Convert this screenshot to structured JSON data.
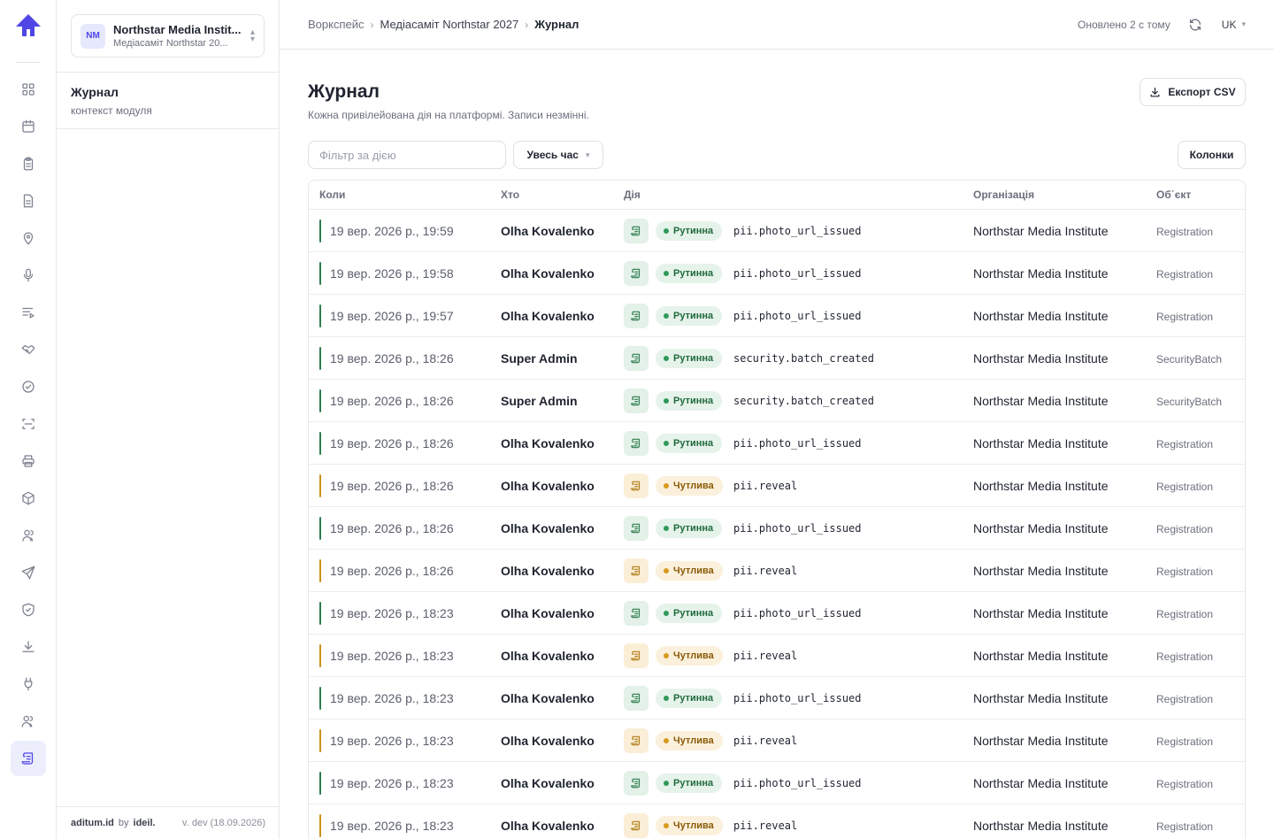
{
  "app": {
    "accent": "#4f46e5"
  },
  "rail": {
    "items": [
      {
        "icon": "dashboard-icon"
      },
      {
        "icon": "calendar-icon"
      },
      {
        "icon": "clipboard-icon"
      },
      {
        "icon": "document-icon"
      },
      {
        "icon": "location-pin-icon"
      },
      {
        "icon": "microphone-icon"
      },
      {
        "icon": "playlist-icon"
      },
      {
        "icon": "handshake-icon"
      },
      {
        "icon": "check-circle-icon"
      },
      {
        "icon": "scan-icon"
      },
      {
        "icon": "printer-icon"
      },
      {
        "icon": "package-icon"
      },
      {
        "icon": "users-icon"
      },
      {
        "icon": "send-icon"
      },
      {
        "icon": "shield-check-icon"
      },
      {
        "icon": "download-icon"
      },
      {
        "icon": "plug-icon"
      },
      {
        "icon": "team-icon"
      },
      {
        "icon": "scroll-icon",
        "active": true
      }
    ]
  },
  "org_switcher": {
    "initials": "NM",
    "name": "Northstar Media Instit...",
    "subtitle": "Медіасаміт Northstar 20..."
  },
  "context": {
    "title": "Журнал",
    "subtitle": "контекст модуля"
  },
  "footer": {
    "brand": "aditum.id",
    "by": "by",
    "vendor": "ideil.",
    "version": "v. dev (18.09.2026)"
  },
  "topbar": {
    "breadcrumb": [
      "Воркспейс",
      "Медіасаміт Northstar 2027",
      "Журнал"
    ],
    "separator": "›",
    "updated": "Оновлено 2 с тому",
    "language": "UK"
  },
  "page": {
    "title": "Журнал",
    "subtitle": "Кожна привілейована дія на платформі. Записи незмінні.",
    "export_label": "Експорт CSV",
    "filter_placeholder": "Фільтр за дією",
    "period_label": "Увесь час",
    "columns_label": "Колонки"
  },
  "table": {
    "headers": {
      "when": "Коли",
      "who": "Хто",
      "action": "Дія",
      "org": "Організація",
      "object": "Об΄єкт"
    },
    "severity_colors": {
      "routine": "#2f7d4f",
      "sensitive": "#c9921e"
    },
    "rows": [
      {
        "when": "19 вер. 2026 р., 19:59",
        "who": "Olha Kovalenko",
        "severity": "routine",
        "badge": "Рутинна",
        "action": "pii.photo_url_issued",
        "org": "Northstar Media Institute",
        "object": "Registration"
      },
      {
        "when": "19 вер. 2026 р., 19:58",
        "who": "Olha Kovalenko",
        "severity": "routine",
        "badge": "Рутинна",
        "action": "pii.photo_url_issued",
        "org": "Northstar Media Institute",
        "object": "Registration"
      },
      {
        "when": "19 вер. 2026 р., 19:57",
        "who": "Olha Kovalenko",
        "severity": "routine",
        "badge": "Рутинна",
        "action": "pii.photo_url_issued",
        "org": "Northstar Media Institute",
        "object": "Registration"
      },
      {
        "when": "19 вер. 2026 р., 18:26",
        "who": "Super Admin",
        "severity": "routine",
        "badge": "Рутинна",
        "action": "security.batch_created",
        "org": "Northstar Media Institute",
        "object": "SecurityBatch"
      },
      {
        "when": "19 вер. 2026 р., 18:26",
        "who": "Super Admin",
        "severity": "routine",
        "badge": "Рутинна",
        "action": "security.batch_created",
        "org": "Northstar Media Institute",
        "object": "SecurityBatch"
      },
      {
        "when": "19 вер. 2026 р., 18:26",
        "who": "Olha Kovalenko",
        "severity": "routine",
        "badge": "Рутинна",
        "action": "pii.photo_url_issued",
        "org": "Northstar Media Institute",
        "object": "Registration"
      },
      {
        "when": "19 вер. 2026 р., 18:26",
        "who": "Olha Kovalenko",
        "severity": "sensitive",
        "badge": "Чутлива",
        "action": "pii.reveal",
        "org": "Northstar Media Institute",
        "object": "Registration"
      },
      {
        "when": "19 вер. 2026 р., 18:26",
        "who": "Olha Kovalenko",
        "severity": "routine",
        "badge": "Рутинна",
        "action": "pii.photo_url_issued",
        "org": "Northstar Media Institute",
        "object": "Registration"
      },
      {
        "when": "19 вер. 2026 р., 18:26",
        "who": "Olha Kovalenko",
        "severity": "sensitive",
        "badge": "Чутлива",
        "action": "pii.reveal",
        "org": "Northstar Media Institute",
        "object": "Registration"
      },
      {
        "when": "19 вер. 2026 р., 18:23",
        "who": "Olha Kovalenko",
        "severity": "routine",
        "badge": "Рутинна",
        "action": "pii.photo_url_issued",
        "org": "Northstar Media Institute",
        "object": "Registration"
      },
      {
        "when": "19 вер. 2026 р., 18:23",
        "who": "Olha Kovalenko",
        "severity": "sensitive",
        "badge": "Чутлива",
        "action": "pii.reveal",
        "org": "Northstar Media Institute",
        "object": "Registration"
      },
      {
        "when": "19 вер. 2026 р., 18:23",
        "who": "Olha Kovalenko",
        "severity": "routine",
        "badge": "Рутинна",
        "action": "pii.photo_url_issued",
        "org": "Northstar Media Institute",
        "object": "Registration"
      },
      {
        "when": "19 вер. 2026 р., 18:23",
        "who": "Olha Kovalenko",
        "severity": "sensitive",
        "badge": "Чутлива",
        "action": "pii.reveal",
        "org": "Northstar Media Institute",
        "object": "Registration"
      },
      {
        "when": "19 вер. 2026 р., 18:23",
        "who": "Olha Kovalenko",
        "severity": "routine",
        "badge": "Рутинна",
        "action": "pii.photo_url_issued",
        "org": "Northstar Media Institute",
        "object": "Registration"
      },
      {
        "when": "19 вер. 2026 р., 18:23",
        "who": "Olha Kovalenko",
        "severity": "sensitive",
        "badge": "Чутлива",
        "action": "pii.reveal",
        "org": "Northstar Media Institute",
        "object": "Registration"
      }
    ]
  }
}
